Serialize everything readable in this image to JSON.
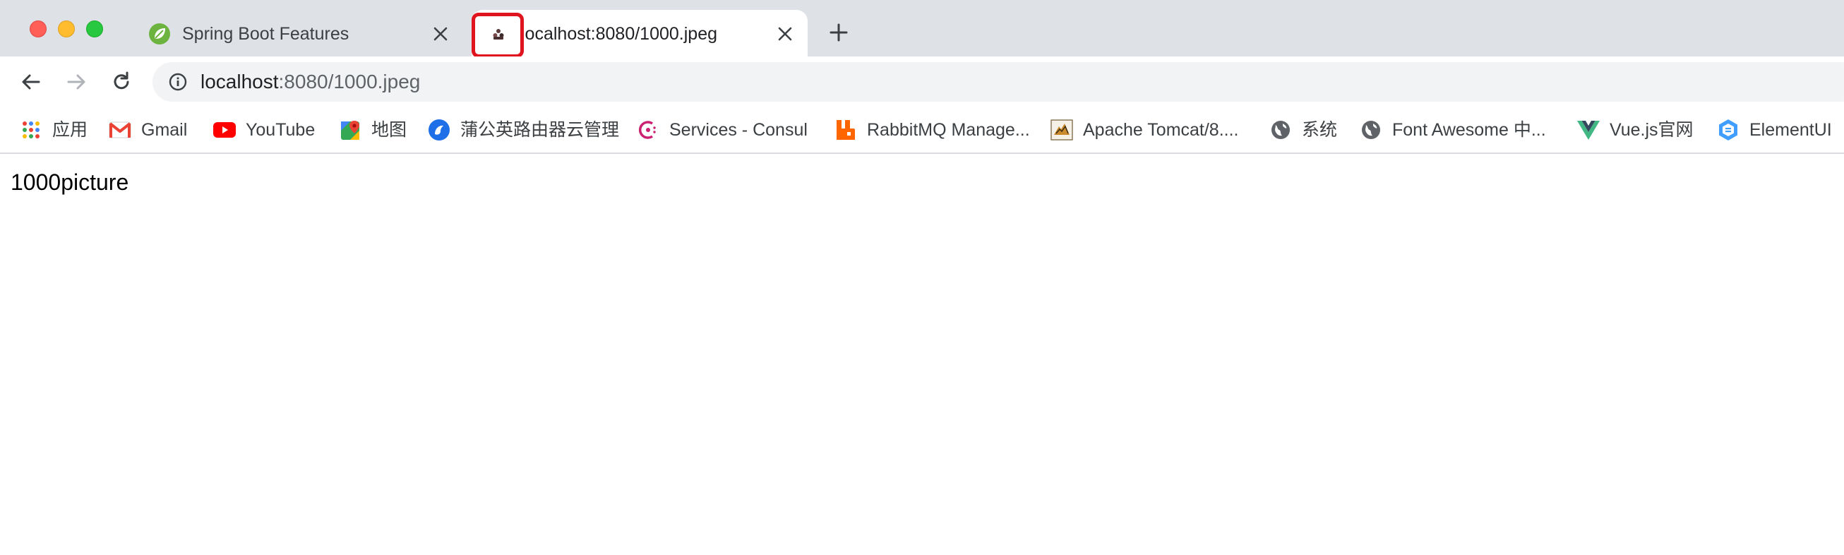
{
  "tabs": [
    {
      "title": "Spring Boot Features",
      "favicon": "spring-leaf-icon",
      "active": false
    },
    {
      "title": "localhost:8080/1000.jpeg",
      "favicon": "image-favicon-icon",
      "active": true
    }
  ],
  "address_bar": {
    "host": "localhost",
    "path": ":8080/1000.jpeg"
  },
  "bookmarks": [
    {
      "label": "应用",
      "icon": "apps-grid-icon"
    },
    {
      "label": "Gmail",
      "icon": "gmail-icon"
    },
    {
      "label": "YouTube",
      "icon": "youtube-icon"
    },
    {
      "label": "地图",
      "icon": "maps-icon"
    },
    {
      "label": "蒲公英路由器云管理",
      "icon": "pgy-icon"
    },
    {
      "label": "Services - Consul",
      "icon": "consul-icon"
    },
    {
      "label": "RabbitMQ Manage...",
      "icon": "rabbitmq-icon"
    },
    {
      "label": "Apache Tomcat/8....",
      "icon": "tomcat-icon"
    },
    {
      "label": "系统",
      "icon": "globe-icon"
    },
    {
      "label": "Font Awesome 中...",
      "icon": "globe-icon"
    },
    {
      "label": "Vue.js官网",
      "icon": "vue-icon"
    },
    {
      "label": "ElementUI",
      "icon": "element-ui-icon"
    }
  ],
  "page": {
    "text": "1000picture"
  },
  "colors": {
    "tabstrip_bg": "#dee1e6",
    "highlight_border": "#e0141e",
    "omnibox_bg": "#f1f3f4"
  }
}
